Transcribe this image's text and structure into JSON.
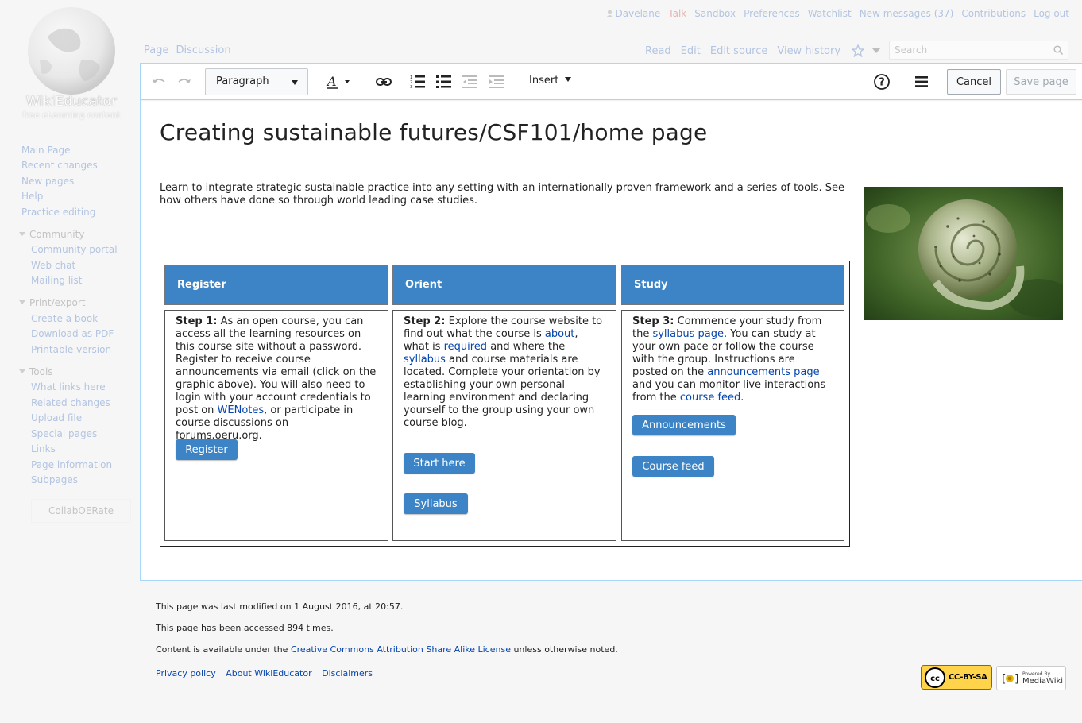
{
  "logo": {
    "wordmark": "WikiEducator",
    "tagline": "free eLearning content"
  },
  "personal_tools": [
    {
      "label": "Davelane",
      "kind": "user"
    },
    {
      "label": "Talk",
      "kind": "talk"
    },
    {
      "label": "Sandbox",
      "kind": "link"
    },
    {
      "label": "Preferences",
      "kind": "link"
    },
    {
      "label": "Watchlist",
      "kind": "link"
    },
    {
      "label": "New messages (37)",
      "kind": "link"
    },
    {
      "label": "Contributions",
      "kind": "link"
    },
    {
      "label": "Log out",
      "kind": "link"
    }
  ],
  "tabs": {
    "page": "Page",
    "discussion": "Discussion",
    "read": "Read",
    "edit": "Edit",
    "edit_source": "Edit source",
    "view_history": "View history"
  },
  "search": {
    "placeholder": "Search"
  },
  "toolbar": {
    "format": "Paragraph",
    "insert": "Insert",
    "cancel": "Cancel",
    "save": "Save page",
    "icons": [
      "undo-icon",
      "redo-icon",
      "text-style-icon",
      "link-icon",
      "numbered-list-icon",
      "bullet-list-icon",
      "outdent-icon",
      "indent-icon",
      "help-icon",
      "page-options-icon"
    ]
  },
  "page": {
    "title": "Creating sustainable futures/CSF101/home page",
    "intro": "Learn to integrate strategic sustainable practice into any setting with an internationally proven framework and a series of tools.  See how others have done so through world leading case studies.",
    "steps": [
      {
        "heading": "Register",
        "step_label": "Step 1:",
        "text_1": " As an open course, you can access all the learning resources on this course site without a password. Register to receive course announcements via email (click on the  graphic above). You will also need to login with your account credentials to post on ",
        "link_1": "WENotes",
        "text_2": ", or participate in course discussions on forums.oeru.org.",
        "buttons": [
          "Register"
        ]
      },
      {
        "heading": "Orient",
        "step_label": "Step 2:",
        "text_1": " Explore the course website to find out what the course is ",
        "link_1": "about",
        "text_2": ", what is ",
        "link_2": "required",
        "text_3": " and where the ",
        "link_3": "syllabus",
        "text_4": " and course materials are located. Complete your orientation by establishing your own personal learning environment and declaring yourself to the group using your own course blog.",
        "buttons": [
          "Start here",
          "Syllabus"
        ]
      },
      {
        "heading": "Study",
        "step_label": "Step 3:",
        "text_1": " Commence your study from the ",
        "link_1": "syllabus page",
        "text_2": ". You can study at your own pace or follow the course with the group. Instructions are posted on the ",
        "link_2": "announcements page",
        "text_3": " and you can monitor live interactions from the ",
        "link_3": "course feed",
        "text_4": ".",
        "buttons": [
          "Announcements",
          "Course feed"
        ]
      }
    ]
  },
  "sidebar": {
    "nav": [
      "Main Page",
      "Recent changes",
      "New pages",
      "Help",
      "Practice editing"
    ],
    "sections": [
      {
        "title": "Community",
        "items": [
          "Community portal",
          "Web chat",
          "Mailing list"
        ]
      },
      {
        "title": "Print/export",
        "items": [
          "Create a book",
          "Download as PDF",
          "Printable version"
        ]
      },
      {
        "title": "Tools",
        "items": [
          "What links here",
          "Related changes",
          "Upload file",
          "Special pages",
          "Links",
          "Page information",
          "Subpages"
        ]
      }
    ],
    "collab_button": "CollabOERate"
  },
  "footer": {
    "last_modified": "This page was last modified on 1 August 2016, at 20:57.",
    "accessed": "This page has been accessed 894 times.",
    "license_prefix": "Content is available under the ",
    "license_link": "Creative Commons Attribution Share Alike License",
    "license_suffix": " unless otherwise noted.",
    "links": [
      "Privacy policy",
      "About WikiEducator",
      "Disclaimers"
    ],
    "badge_cc": "CC-BY-SA",
    "badge_mw_small": "Powered By",
    "badge_mw_big": "MediaWiki"
  },
  "colors": {
    "step_header": "#3c84c6",
    "link": "#0645ad",
    "content_border": "#a7d7f9"
  }
}
